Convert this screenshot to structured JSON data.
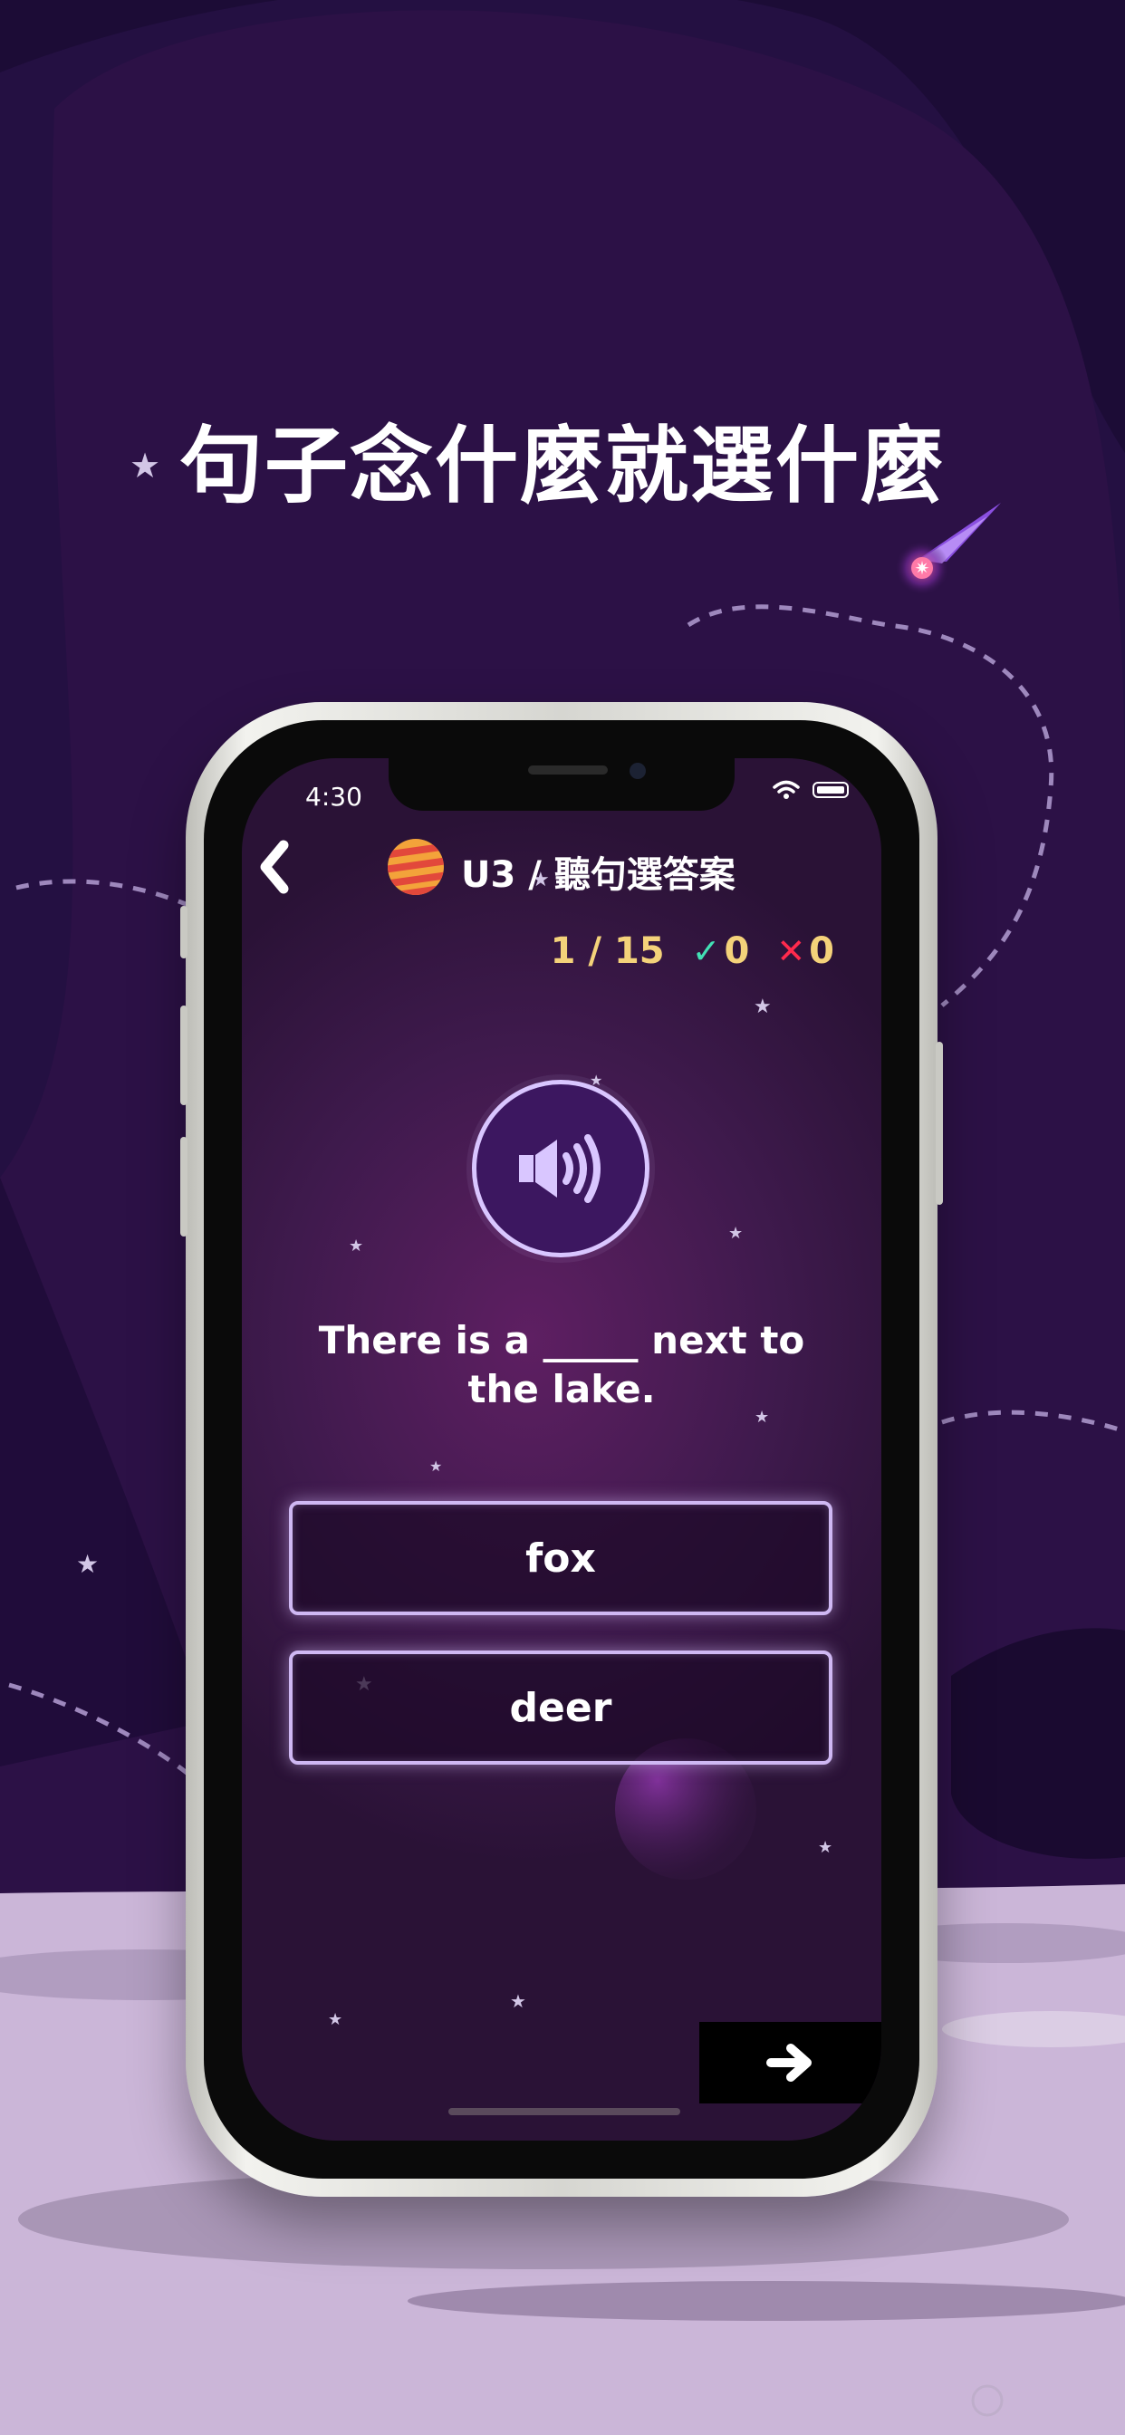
{
  "headline": "句子念什麼就選什麼",
  "status_bar": {
    "time": "4:30"
  },
  "header": {
    "title": "U3 / 聽句選答案"
  },
  "progress": {
    "counter": "1 / 15",
    "correct_count": "0",
    "wrong_count": "0"
  },
  "question": {
    "sentence": "There is a _____ next to the lake."
  },
  "options": [
    {
      "label": "fox"
    },
    {
      "label": "deer"
    }
  ],
  "colors": {
    "background": "#2a0f45",
    "accent": "#cfb8f3",
    "score_text": "#f4d27a",
    "correct": "#43e0b5",
    "wrong": "#ff2a4d"
  },
  "icons": [
    "back-chevron-icon",
    "planet-icon",
    "speaker-icon",
    "check-icon",
    "cross-icon",
    "arrow-right-icon",
    "wifi-icon",
    "battery-icon",
    "comet-icon"
  ]
}
